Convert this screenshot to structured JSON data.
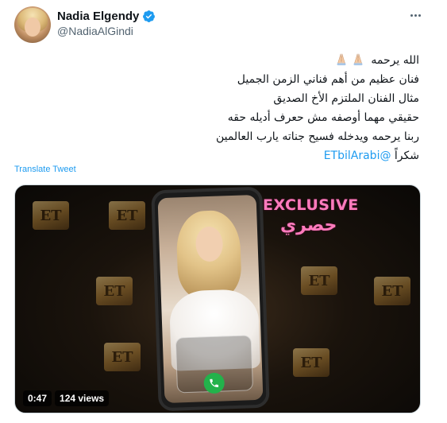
{
  "author": {
    "display_name": "Nadia Elgendy",
    "handle": "@NadiaAlGindi",
    "verified_icon": "verified-badge-icon"
  },
  "menu": {
    "more_icon": "more-dots-icon"
  },
  "tweet": {
    "lines": [
      "الله يرحمه",
      "فنان عظيم من أهم فناني الزمن الجميل",
      "مثال الفنان الملتزم الأخ الصديق",
      "حقيقي مهما أوصفه مش حعرف أديله حقه",
      "ربنا يرحمه ويدخله فسيح جناته يارب العالمين"
    ],
    "last_line_prefix": "شكراً ",
    "mention": "@ETbilArabi"
  },
  "translate_label": "Translate Tweet",
  "media": {
    "overlay_en": "EXCLUSIVE",
    "overlay_ar": "حصري",
    "logo_text": "ET",
    "duration": "0:47",
    "views": "124 views"
  },
  "colors": {
    "link": "#1d9bf0",
    "text": "#0f1419",
    "muted": "#536471",
    "overlay_pink": "#ff7bbd"
  }
}
